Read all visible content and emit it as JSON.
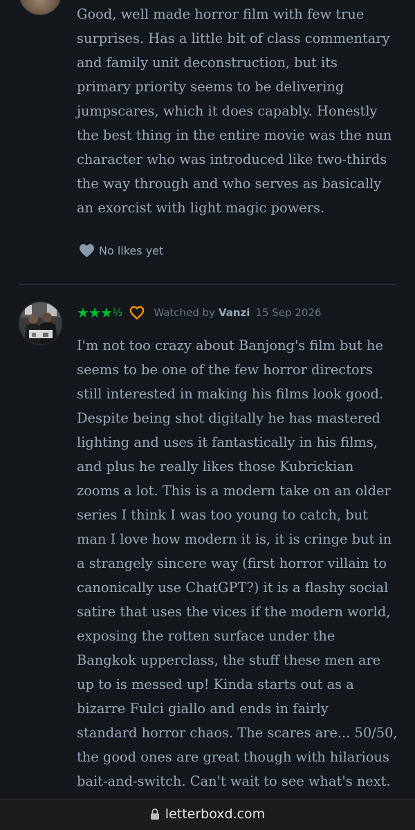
{
  "reviews": [
    {
      "body_lines": [
        "Good, well made horror film with few true",
        "surprises. Has a little bit of class commentary",
        "and family unit deconstruction, but its",
        "primary priority seems to be delivering",
        "jumpscares, which it does capably. Honestly",
        "the best thing in the entire movie was the nun",
        "character who was introduced like two-thirds",
        "the way through and who serves as basically",
        "an exorcist with light magic powers."
      ],
      "likes_label": "No likes yet"
    },
    {
      "rating_stars": "★★★",
      "rating_half": "½",
      "liked": true,
      "watched_by_label": "Watched by",
      "username": "Vanzi",
      "date": "15 Sep 2026",
      "body_lines": [
        "I'm not too crazy about Banjong's film but he",
        "seems to be one of the few horror directors",
        "still interested in making his films look good.",
        "Despite being shot digitally he has mastered",
        "lighting and uses it fantastically in his films,",
        "and plus he really likes those Kubrickian",
        "zooms a lot. This is a modern take on an older",
        "series I think I was too young to catch, but",
        "man I love how modern it is, it is cringe but in",
        "a strangely sincere way (first horror villain to",
        "canonically use ChatGPT?) it is a flashy social",
        "satire that uses the vices if the modern world,",
        "exposing the rotten surface under the",
        "Bangkok upperclass, the stuff these men are",
        "up to is messed up! Kinda starts out as a",
        "bizarre Fulci giallo and ends in fairly",
        "standard horror chaos. The scares are... 50/50,",
        "the good ones are great though with hilarious",
        "bait-and-switch. Can't wait to see what's next."
      ]
    }
  ],
  "browser": {
    "url": "letterboxd.com"
  },
  "colors": {
    "background": "#14181c",
    "body_text": "#99aabb",
    "star_green": "#00c030",
    "like_orange": "#ff9010",
    "muted": "#667788"
  }
}
